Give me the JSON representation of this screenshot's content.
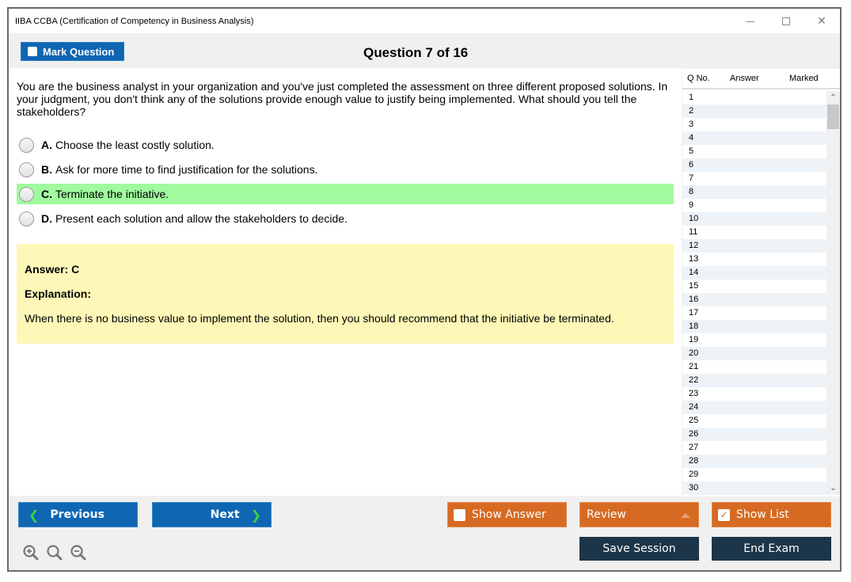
{
  "window": {
    "title": "IIBA CCBA (Certification of Competency in Business Analysis)",
    "controls": [
      "minimize",
      "maximize",
      "close"
    ]
  },
  "header": {
    "mark_question_label": "Mark Question",
    "mark_question_checked": false,
    "question_counter": "Question 7 of 16"
  },
  "question": {
    "text": "You are the business analyst in your organization and you've just completed the assessment on three different proposed solutions. In your judgment, you don't think any of the solutions provide enough value to justify being implemented. What should you tell the stakeholders?",
    "options": [
      {
        "letter": "A.",
        "text": "Choose the least costly solution.",
        "correct": false
      },
      {
        "letter": "B.",
        "text": "Ask for more time to find justification for the solutions.",
        "correct": false
      },
      {
        "letter": "C.",
        "text": "Terminate the initiative.",
        "correct": true
      },
      {
        "letter": "D.",
        "text": "Present each solution and allow the stakeholders to decide.",
        "correct": false
      }
    ],
    "highlight_color": "#a0fa9e"
  },
  "answer_panel": {
    "answer": "Answer: C",
    "explanation_label": "Explanation:",
    "explanation": "When there is no business value to implement the solution, then you should recommend that the initiative be terminated.",
    "background_color": "#fdf8b7"
  },
  "question_list": {
    "columns": [
      "Q No.",
      "Answer",
      "Marked"
    ],
    "rows": [
      "1",
      "2",
      "3",
      "4",
      "5",
      "6",
      "7",
      "8",
      "9",
      "10",
      "11",
      "12",
      "13",
      "14",
      "15",
      "16",
      "17",
      "18",
      "19",
      "20",
      "21",
      "22",
      "23",
      "24",
      "25",
      "26",
      "27",
      "28",
      "29",
      "30"
    ]
  },
  "footer": {
    "previous_label": "Previous",
    "next_label": "Next",
    "show_answer_label": "Show Answer",
    "show_answer_checked": false,
    "review_label": "Review",
    "show_list_label": "Show List",
    "show_list_checked": true,
    "save_session_label": "Save Session",
    "end_exam_label": "End Exam",
    "zoom_icons": [
      "zoom-in-icon",
      "zoom-reset-icon",
      "zoom-out-icon"
    ]
  },
  "colors": {
    "primary_blue": "#0f66b3",
    "orange": "#d66a22",
    "navy": "#1c3549",
    "chevron_green": "#3fd03f"
  }
}
